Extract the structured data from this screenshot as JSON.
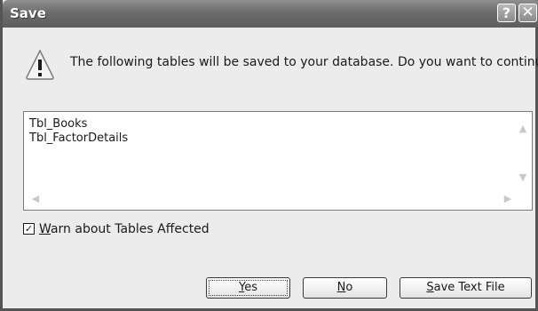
{
  "window": {
    "title": "Save",
    "help_glyph": "?",
    "close_glyph": "✕"
  },
  "message": {
    "icon": "warning-icon",
    "text": "The following tables will be saved to your database. Do you want to continue?"
  },
  "tables_list": {
    "items": [
      "Tbl_Books",
      "Tbl_FactorDetails"
    ]
  },
  "checkbox": {
    "label": "Warn about Tables Affected",
    "checked": true
  },
  "buttons": {
    "yes": "Yes",
    "no": "No",
    "save_text_file": "Save Text File"
  },
  "colors": {
    "titlebar": "#6c6c6c",
    "dialog_bg": "#ececec",
    "warning_fill": "#f7f7f7"
  }
}
